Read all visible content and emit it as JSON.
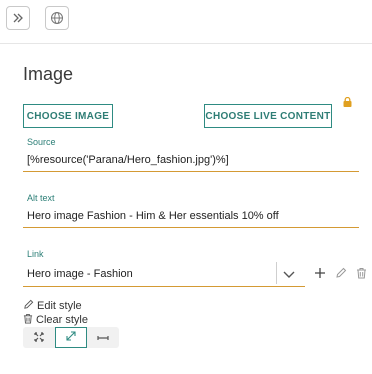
{
  "toolbar": {
    "expand_icon": "chevron-double-right-icon",
    "globe_icon": "globe-icon"
  },
  "panel": {
    "title": "Image",
    "lock_icon": "lock-icon",
    "choose_image_label": "CHOOSE IMAGE",
    "choose_live_content_label": "CHOOSE LIVE CONTENT"
  },
  "fields": {
    "source": {
      "label": "Source",
      "value": "[%resource('Parana/Hero_fashion.jpg')%]"
    },
    "alt_text": {
      "label": "Alt text",
      "value": "Hero image Fashion - Him & Her essentials 10% off"
    },
    "link": {
      "label": "Link",
      "value": "Hero image - Fashion"
    }
  },
  "style": {
    "edit_label": "Edit style",
    "clear_label": "Clear style",
    "size_options": [
      "fit-icon",
      "stretch-icon",
      "horizontal-icon"
    ],
    "active_option": "stretch-icon"
  },
  "colors": {
    "accent": "#2e8b82",
    "underline": "#d49a34",
    "lock": "#e0a020"
  }
}
